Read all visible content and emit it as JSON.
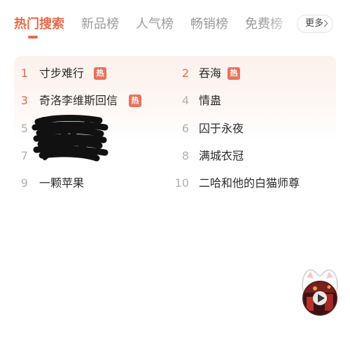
{
  "tabs": [
    {
      "label": "热门搜索",
      "active": true
    },
    {
      "label": "新品榜",
      "active": false
    },
    {
      "label": "人气榜",
      "active": false
    },
    {
      "label": "畅销榜",
      "active": false
    },
    {
      "label": "免费榜",
      "active": false
    }
  ],
  "more_button": {
    "label": "更多",
    "icon": "chevron-right-icon"
  },
  "hot_badge_label": "热",
  "ranking": [
    {
      "rank": "1",
      "title": "寸步难行",
      "hot": true
    },
    {
      "rank": "2",
      "title": "吞海",
      "hot": true
    },
    {
      "rank": "3",
      "title": "奇洛李维斯回信",
      "hot": true
    },
    {
      "rank": "4",
      "title": "情蛊",
      "hot": false
    },
    {
      "rank": "5",
      "title": "",
      "hot": false,
      "redacted": true
    },
    {
      "rank": "6",
      "title": "囚于永夜",
      "hot": false
    },
    {
      "rank": "7",
      "title": "",
      "hot": false,
      "redacted": true
    },
    {
      "rank": "8",
      "title": "满城衣冠",
      "hot": false
    },
    {
      "rank": "9",
      "title": "一颗苹果",
      "hot": false
    },
    {
      "rank": "10",
      "title": "二哈和他的白猫师尊",
      "hot": false
    }
  ],
  "colors": {
    "accent": "#e8694a",
    "badge": "#e8735a",
    "rank_muted": "#b0b0b0",
    "tab_inactive": "#9b9b9b"
  },
  "player": {
    "icon": "play-icon",
    "mascot": "cat-ears-icon"
  }
}
